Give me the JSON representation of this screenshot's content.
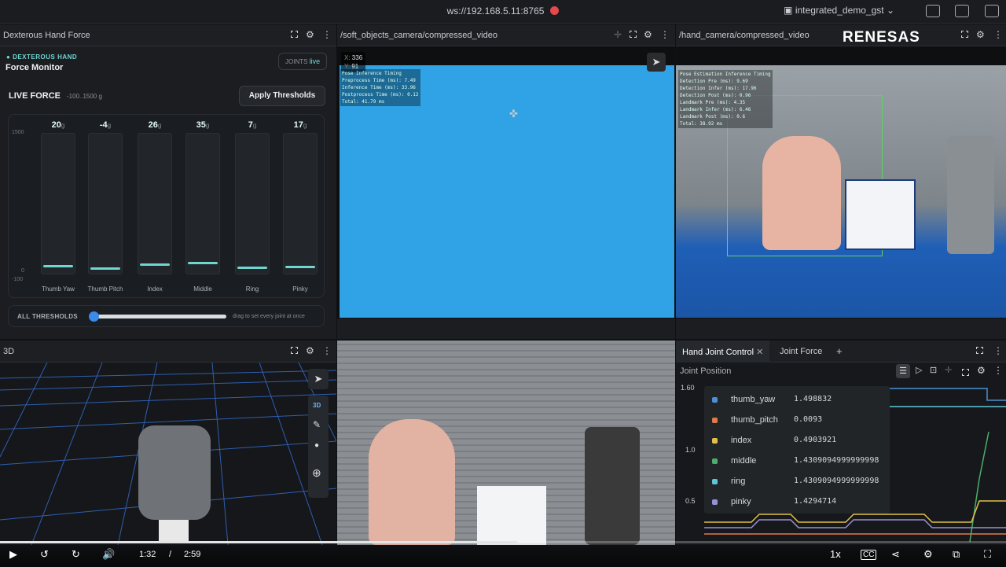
{
  "topbar": {
    "url": "ws://192.168.5.11:8765",
    "layout": "integrated_demo_gst",
    "chevron": "⌄"
  },
  "force": {
    "panel_title": "Dexterous Hand Force",
    "badge": "DEXTEROUS HAND",
    "title": "Force Monitor",
    "chip_label": "JOINTS",
    "chip_status": "live",
    "live_label": "LIVE FORCE",
    "range": "-100..1500 g",
    "apply": "Apply Thresholds",
    "axis_top": "1500",
    "axis_zero": "0",
    "axis_bottom": "-100",
    "unit": "g",
    "bars": [
      {
        "label": "Thumb Yaw",
        "value": "20",
        "fraction": 0.08
      },
      {
        "label": "Thumb Pitch",
        "value": "-4",
        "fraction": 0.06
      },
      {
        "label": "Index",
        "value": "26",
        "fraction": 0.09
      },
      {
        "label": "Middle",
        "value": "35",
        "fraction": 0.1
      },
      {
        "label": "Ring",
        "value": "7",
        "fraction": 0.065
      },
      {
        "label": "Pinky",
        "value": "17",
        "fraction": 0.075
      }
    ],
    "thresholds_label": "ALL THRESHOLDS",
    "thresholds_hint": "drag to set every joint at once",
    "threshold_level": 0.0
  },
  "cam1": {
    "title": "/soft_objects_camera/compressed_video",
    "x_label": "X:",
    "x": "336",
    "y_label": "Y:",
    "y": "91",
    "overlay": [
      "Pose Inference Timing",
      "Preprocess Time (ms): 7.49",
      "Inference Time (ms): 33.96",
      "Postprocess Time (ms): 0.12",
      "Total: 41.79 ms"
    ],
    "bg": "#2fa3e6"
  },
  "cam2": {
    "title": "/hand_camera/compressed_video",
    "brand": "RENESAS",
    "overlay": [
      "Pose Estimation Inference Timing",
      "Detection Pre (ms): 9.69",
      "Detection Infer (ms): 17.96",
      "Detection Post (ms): 0.96",
      "Landmark Pre (ms): 4.35",
      "Landmark Infer (ms): 6.46",
      "Landmark Post (ms): 0.6",
      "Total: 38.92 ms"
    ]
  },
  "p3d": {
    "title": "3D",
    "mode": "3D"
  },
  "joints": {
    "tabs": [
      "Hand Joint Control",
      "Joint Force"
    ],
    "add": "+",
    "subtitle": "Joint Position",
    "y_ticks": [
      "1.60",
      "1.0",
      "0.5"
    ],
    "legend": [
      {
        "name": "thumb_yaw",
        "value": "1.498832",
        "color": "#4c8fd6"
      },
      {
        "name": "thumb_pitch",
        "value": "0.0093",
        "color": "#e07a4a"
      },
      {
        "name": "index",
        "value": "0.4903921",
        "color": "#e0c04a"
      },
      {
        "name": "middle",
        "value": "1.4309094999999998",
        "color": "#4cae6a"
      },
      {
        "name": "ring",
        "value": "1.4309094999999998",
        "color": "#5fc6d6"
      },
      {
        "name": "pinky",
        "value": "1.4294714",
        "color": "#9a8fd6"
      }
    ]
  },
  "player": {
    "current": "1:32",
    "sep": "/",
    "total": "2:59",
    "speed": "1x",
    "progress": 0.514
  }
}
